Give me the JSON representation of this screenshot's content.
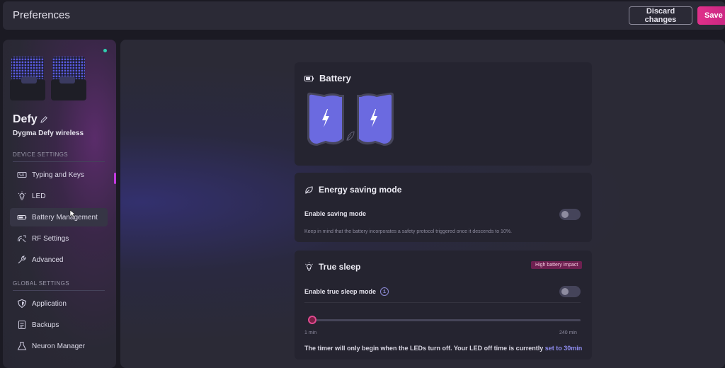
{
  "header": {
    "title": "Preferences",
    "discard_label": "Discard changes",
    "save_label": "Save changes"
  },
  "sidebar": {
    "device_name": "Defy",
    "device_model": "Dygma Defy wireless",
    "device_section": "DEVICE SETTINGS",
    "device_items": [
      {
        "label": "Typing and Keys",
        "icon": "keyboard-icon"
      },
      {
        "label": "LED",
        "icon": "bulb-icon"
      },
      {
        "label": "Battery Management",
        "icon": "battery-icon",
        "active": true
      },
      {
        "label": "RF Settings",
        "icon": "rf-icon"
      },
      {
        "label": "Advanced",
        "icon": "wrench-icon"
      }
    ],
    "global_section": "GLOBAL SETTINGS",
    "global_items": [
      {
        "label": "Application",
        "icon": "shield-icon"
      },
      {
        "label": "Backups",
        "icon": "backup-icon"
      },
      {
        "label": "Neuron Manager",
        "icon": "neuron-icon"
      }
    ]
  },
  "battery": {
    "title": "Battery"
  },
  "energy": {
    "title": "Energy saving mode",
    "toggle_label": "Enable saving mode",
    "hint": "Keep in mind that the battery incorporates a safety protocol triggered once it descends to 10%."
  },
  "sleep": {
    "title": "True sleep",
    "badge": "High battery impact",
    "toggle_label": "Enable true sleep mode",
    "info": "i",
    "slider_min": "1 min",
    "slider_max": "240 min",
    "note": "The timer will only begin when the LEDs turn off. Your LED off time is currently ",
    "note_link": "set to 30min"
  },
  "colors": {
    "accent": "#e0308a",
    "battery_fill": "#6b6ae0",
    "badge_bg": "#6e2050",
    "link": "#8f8df0"
  }
}
